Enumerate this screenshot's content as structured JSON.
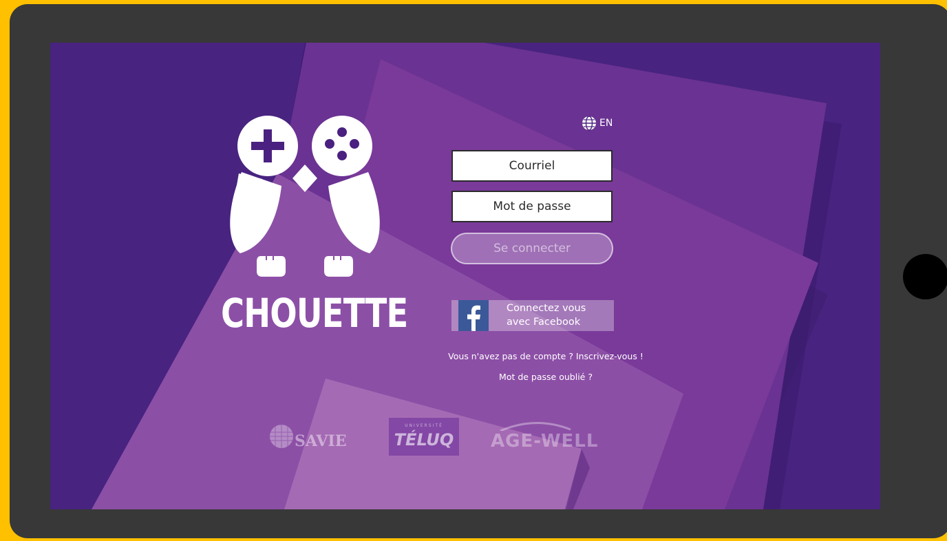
{
  "app": {
    "brand_name": "CHOUETTE",
    "language": "EN"
  },
  "login": {
    "email_placeholder": "Courriel",
    "password_placeholder": "Mot de passe",
    "connect_label": "Se connecter",
    "facebook_label": "Connectez vous avec Facebook",
    "signup_link": "Vous n'avez pas de compte ? Inscrivez-vous !",
    "forgot_link": "Mot de passe oublié ?"
  },
  "partners": {
    "savie": "SAVIE",
    "teluq_small": "UNIVERSITÉ",
    "teluq": "TÉLUQ",
    "agewell": "AGE-WELL"
  },
  "icons": {
    "language": "globe-icon",
    "facebook": "facebook-icon",
    "logo": "owl-gamepad-logo"
  },
  "colors": {
    "frame": "#FFC000",
    "tablet": "#383838",
    "background": "#482380",
    "accent": "#8A4FA8",
    "facebook": "#3B5998"
  }
}
